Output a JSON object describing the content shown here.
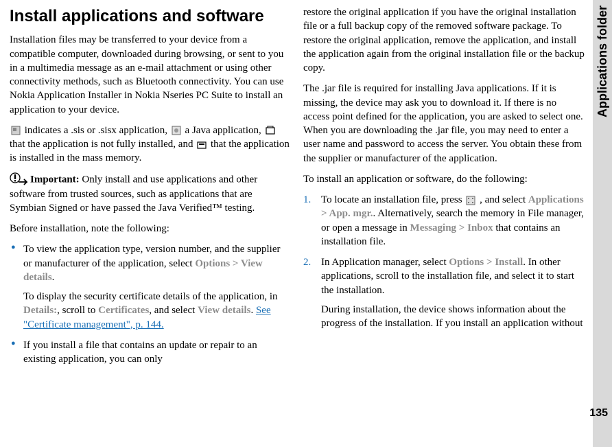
{
  "sidetab": "Applications folder",
  "pagenum": "135",
  "heading": "Install applications and software",
  "col1": {
    "p1": "Installation files may be transferred to your device from a compatible computer, downloaded during browsing, or sent to you in a multimedia message as an e-mail attachment or using other connectivity methods, such as Bluetooth connectivity. You can use Nokia Application Installer in Nokia Nseries PC Suite to install an application to your device.",
    "ic_a": " indicates a .sis or .sisx application, ",
    "ic_b": " a Java application, ",
    "ic_c": " that the application is not fully installed, and ",
    "ic_d": " that the application is installed in the mass memory.",
    "imp_label": "Important:",
    "imp_text": "  Only install and use applications and other software from trusted sources, such as applications that are Symbian Signed or have passed the Java Verified™ testing.",
    "before": "Before installation, note the following:",
    "b1a": "To view the application type, version number, and the supplier or manufacturer of the application, select ",
    "b1_options": "Options",
    "b1_gt": " > ",
    "b1_view": "View details",
    "b1_dot": ".",
    "b1b_a": "To display the security certificate details of the application, in ",
    "b1b_details": "Details:",
    "b1b_b": ", scroll to ",
    "b1b_cert": "Certificates",
    "b1b_c": ", and select ",
    "b1b_view": "View details",
    "b1b_d": ". ",
    "b1b_link": "See \"Certificate management\", p. 144.",
    "b2": "If you install a file that contains an update or repair to an existing application, you can only"
  },
  "col2": {
    "p1": "restore the original application if you have the original installation file or a full backup copy of the removed software package. To restore the original application, remove the application, and install the application again from the original installation file or the backup copy.",
    "p2": "The .jar file is required for installing Java applications. If it is missing, the device may ask you to download it. If there is no access point defined for the application, you are asked to select one. When you are downloading the .jar file, you may need to enter a user name and password to access the server. You obtain these from the supplier or manufacturer of the application.",
    "p3": "To install an application or software, do the following:",
    "n1a": "To locate an installation file, press ",
    "n1b": " , and select ",
    "n1_apps": "Applications",
    "n1_gt": " > ",
    "n1_mgr": "App. mgr.",
    "n1c": ". Alternatively, search the memory in File manager, or open a message in ",
    "n1_msg": "Messaging",
    "n1_inbox": "Inbox",
    "n1d": " that contains an installation file.",
    "n2a": "In Application manager, select ",
    "n2_opt": "Options",
    "n2_gt": " > ",
    "n2_inst": "Install",
    "n2b": ". In other applications, scroll to the installation file, and select it to start the installation.",
    "n2c": "During installation, the device shows information about the progress of the installation. If you install an application without"
  }
}
